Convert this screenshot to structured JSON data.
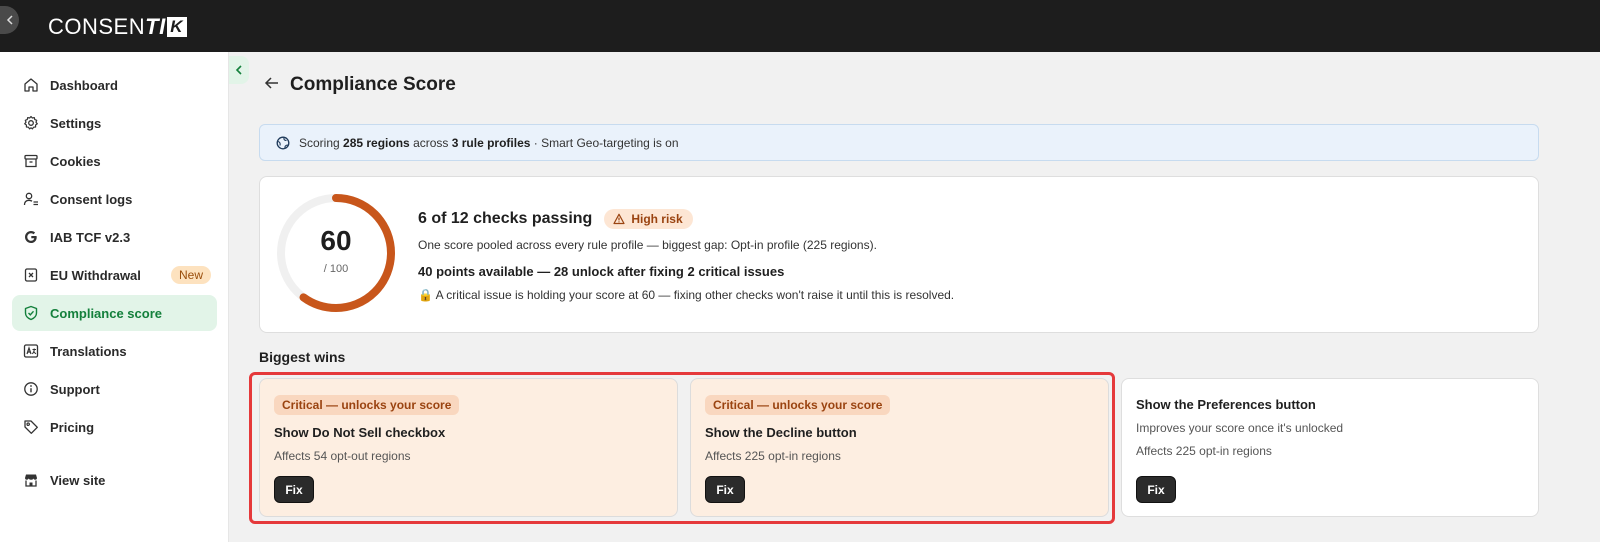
{
  "app": {
    "logo_main": "CONSEN",
    "logo_ti": "TI",
    "logo_k": "K"
  },
  "sidebar": {
    "items": [
      {
        "label": "Dashboard",
        "icon": "home-icon"
      },
      {
        "label": "Settings",
        "icon": "gear-icon"
      },
      {
        "label": "Cookies",
        "icon": "archive-icon"
      },
      {
        "label": "Consent logs",
        "icon": "user-list-icon"
      },
      {
        "label": "IAB TCF v2.3",
        "icon": "google-g-icon"
      },
      {
        "label": "EU Withdrawal",
        "icon": "withdrawal-icon",
        "badge": "New"
      },
      {
        "label": "Compliance score",
        "icon": "shield-check-icon",
        "active": true
      },
      {
        "label": "Translations",
        "icon": "translate-icon"
      },
      {
        "label": "Support",
        "icon": "info-icon"
      },
      {
        "label": "Pricing",
        "icon": "tag-icon"
      },
      {
        "label": "View site",
        "icon": "storefront-icon"
      }
    ]
  },
  "page": {
    "title": "Compliance Score"
  },
  "banner": {
    "prefix": "Scoring ",
    "regions": "285 regions",
    "mid": " across ",
    "profiles": "3 rule profiles",
    "suffix": " · Smart Geo-targeting is on"
  },
  "score": {
    "value": "60",
    "denominator": "/ 100",
    "fraction": 0.6,
    "checks": "6 of 12 checks passing",
    "risk": "High risk",
    "line1": "One score pooled across every rule profile — biggest gap: Opt-in profile (225 regions).",
    "line2": "40 points available — 28 unlock after fixing 2 critical issues",
    "line3": "🔒 A critical issue is holding your score at 60 — fixing other checks won't raise it until this is resolved."
  },
  "wins": {
    "title": "Biggest wins",
    "cards": [
      {
        "badge": "Critical — unlocks your score",
        "title": "Show Do Not Sell checkbox",
        "sub": "Affects 54 opt-out regions",
        "button": "Fix"
      },
      {
        "badge": "Critical — unlocks your score",
        "title": "Show the Decline button",
        "sub": "Affects 225 opt-in regions",
        "button": "Fix"
      },
      {
        "title": "Show the Preferences button",
        "sub1": "Improves your score once it's unlocked",
        "sub2": "Affects 225 opt-in regions",
        "button": "Fix"
      }
    ]
  },
  "colors": {
    "accent_green": "#14803c",
    "gauge_orange": "#c8561b",
    "highlight_red": "#e5393b"
  }
}
